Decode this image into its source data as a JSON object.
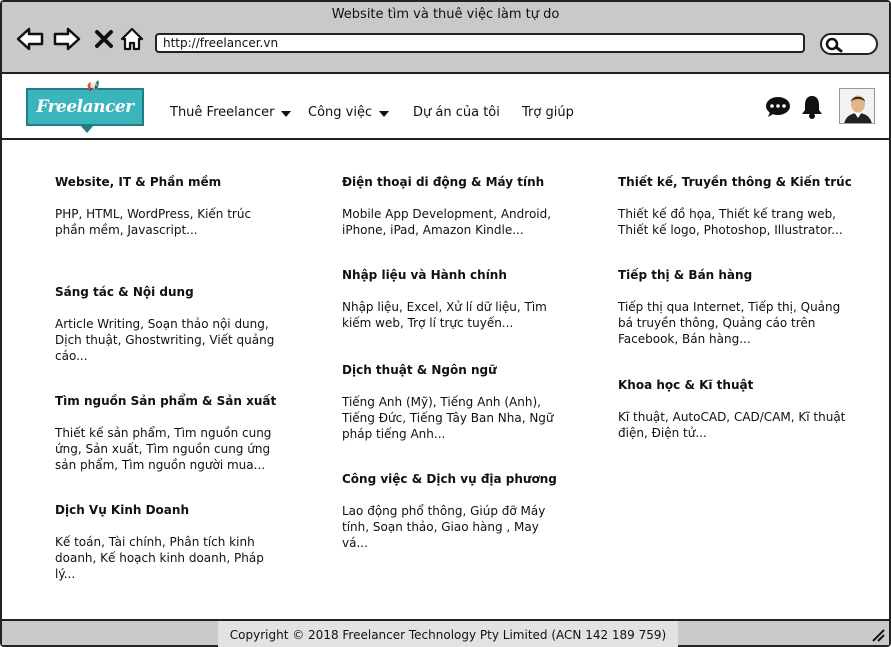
{
  "browser": {
    "title": "Website tìm và thuê việc làm tự do",
    "url": "http://freelancer.vn"
  },
  "header": {
    "logo_text": "Freelancer",
    "menu": [
      {
        "label": "Thuê Freelancer",
        "dropdown": true
      },
      {
        "label": "Công việc",
        "dropdown": true
      },
      {
        "label": "Dự án của tôi",
        "dropdown": false
      },
      {
        "label": "Trợ giúp",
        "dropdown": false
      }
    ],
    "icons": [
      "chat-icon",
      "bell-icon",
      "avatar"
    ]
  },
  "categories": {
    "col1": [
      {
        "title": "Website, IT & Phần mềm",
        "items": "PHP, HTML, WordPress, Kiến trúc phần mềm, Javascript..."
      },
      {
        "title": "Sáng tác & Nội dung",
        "items": "Article Writing, Soạn thảo nội dung, Dịch thuật, Ghostwriting, Viết quảng cáo..."
      },
      {
        "title": "Tìm nguồn Sản phẩm & Sản xuất",
        "items": "Thiết kế sản phẩm, Tìm nguồn cung ứng, Sản xuất, Tìm nguồn cung ứng sản phẩm, Tìm nguồn người mua..."
      },
      {
        "title": "Dịch Vụ Kinh Doanh",
        "items": "Kế toán, Tài chính, Phân tích kinh doanh, Kế hoạch kinh doanh, Pháp lý..."
      }
    ],
    "col2": [
      {
        "title": "Điện thoại di động & Máy tính",
        "items": "Mobile App Development, Android, iPhone, iPad, Amazon Kindle..."
      },
      {
        "title": "Nhập liệu và Hành chính",
        "items": "Nhập liệu, Excel, Xử lí dữ liệu, Tìm kiếm web, Trợ lí trực tuyến..."
      },
      {
        "title": "Dịch thuật & Ngôn ngữ",
        "items": "Tiếng Anh (Mỹ), Tiếng Anh (Anh), Tiếng Đức, Tiếng Tây Ban Nha, Ngữ pháp tiếng Anh..."
      },
      {
        "title": "Công việc & Dịch vụ địa phương",
        "items": "Lao động phổ thông, Giúp đỡ Máy tính, Soạn thảo, Giao hàng , May vá..."
      }
    ],
    "col3": [
      {
        "title": "Thiết kế, Truyền thông & Kiến trúc",
        "items": "Thiết kế đồ họa, Thiết kế trang web, Thiết kế logo, Photoshop, Illustrator..."
      },
      {
        "title": "Tiếp thị & Bán hàng",
        "items": "Tiếp thị qua Internet, Tiếp thị, Quảng bá truyền thông, Quảng cáo trên Facebook, Bán hàng..."
      },
      {
        "title": "Khoa học & Kĩ thuật",
        "items": "Kĩ thuật, AutoCAD, CAD/CAM, Kĩ thuật điện, Điện tử..."
      }
    ]
  },
  "footer": {
    "copyright": "Copyright © 2018 Freelancer Technology Pty Limited (ACN 142 189 759)"
  }
}
